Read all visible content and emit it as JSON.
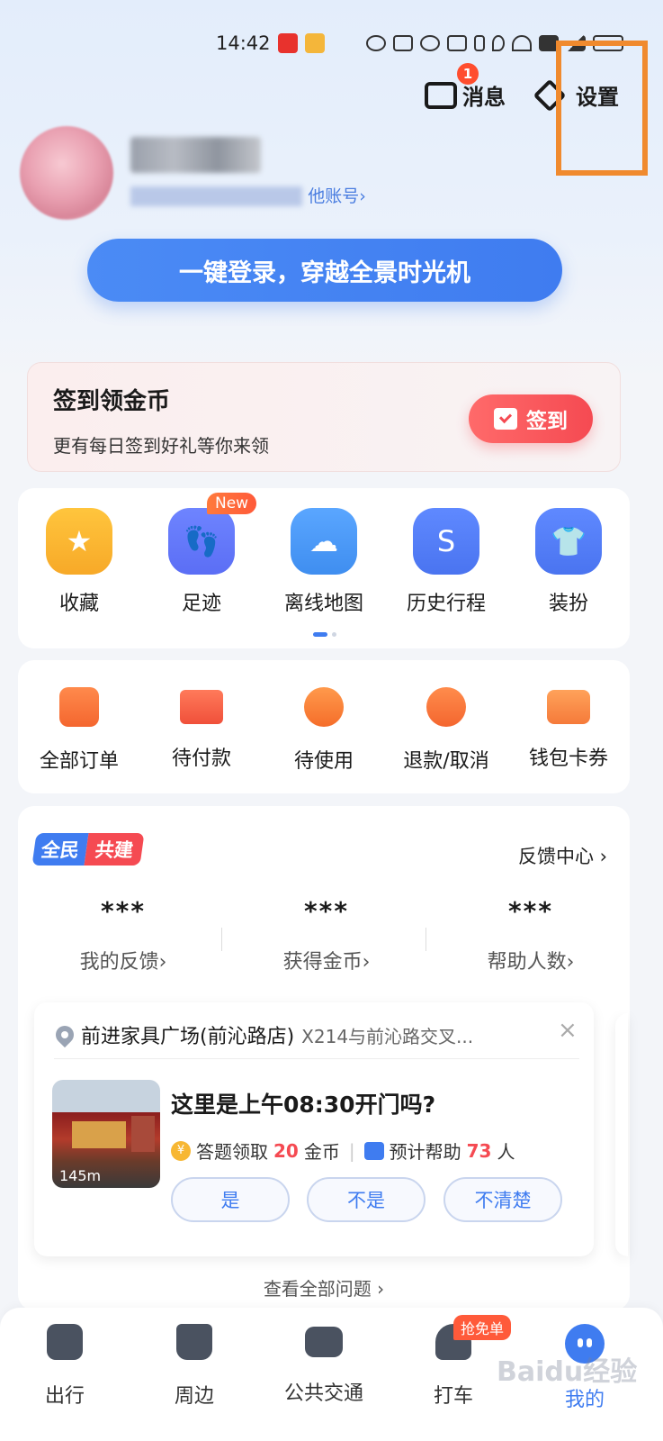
{
  "status_bar": {
    "time": "14:42"
  },
  "header": {
    "messages": {
      "label": "消息",
      "badge": "1"
    },
    "settings": {
      "label": "设置"
    }
  },
  "profile": {
    "other_account_suffix": "他账号›"
  },
  "login_button": "一键登录，穿越全景时光机",
  "signin": {
    "title": "签到领金币",
    "subtitle": "更有每日签到好礼等你来领",
    "button": "签到"
  },
  "quick_actions": [
    {
      "label": "收藏",
      "icon": "star-icon",
      "color": "#f7a928"
    },
    {
      "label": "足迹",
      "icon": "footprint-icon",
      "color": "#5b6ef5",
      "tag": "New"
    },
    {
      "label": "离线地图",
      "icon": "cloud-download-icon",
      "color": "#3f8ef0"
    },
    {
      "label": "历史行程",
      "icon": "route-icon",
      "color": "#4a74f0"
    },
    {
      "label": "装扮",
      "icon": "shirt-icon",
      "color": "#4a74f0"
    }
  ],
  "orders": [
    {
      "label": "全部订单",
      "icon": "order-icon"
    },
    {
      "label": "待付款",
      "icon": "card-icon"
    },
    {
      "label": "待使用",
      "icon": "clock-icon"
    },
    {
      "label": "退款/取消",
      "icon": "refund-icon"
    },
    {
      "label": "钱包卡券",
      "icon": "wallet-icon"
    }
  ],
  "community": {
    "logo_a": "全民",
    "logo_b": "共建",
    "feedback_center": "反馈中心",
    "stats": [
      {
        "value": "***",
        "label": "我的反馈›"
      },
      {
        "value": "***",
        "label": "获得金币›"
      },
      {
        "value": "***",
        "label": "帮助人数›"
      }
    ],
    "question": {
      "place": "前进家具广场(前沁路店)",
      "address": "X214与前沁路交叉...",
      "distance": "145m",
      "text": "这里是上午08:30开门吗?",
      "reward_prefix": "答题领取",
      "reward_amount": "20",
      "reward_suffix": "金币",
      "help_prefix": "预计帮助",
      "help_count": "73",
      "help_suffix": "人",
      "answers": [
        "是",
        "不是",
        "不清楚"
      ]
    },
    "view_all": "查看全部问题 ›"
  },
  "bottom_nav": [
    {
      "label": "出行",
      "icon": "travel-icon"
    },
    {
      "label": "周边",
      "icon": "bag-icon"
    },
    {
      "label": "公共交通",
      "icon": "bus-stop-icon"
    },
    {
      "label": "打车",
      "icon": "taxi-icon",
      "tag": "抢免单"
    },
    {
      "label": "我的",
      "icon": "me-icon",
      "active": true
    }
  ],
  "watermark": "Baidu经验"
}
